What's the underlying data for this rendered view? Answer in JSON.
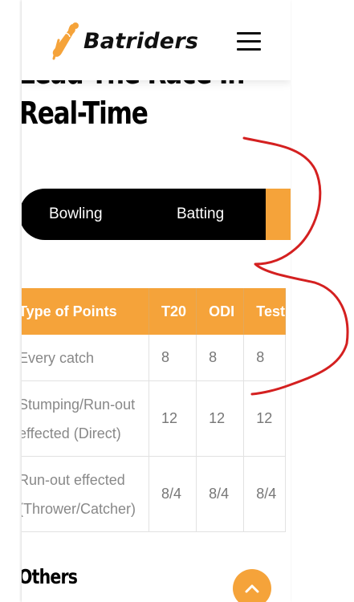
{
  "brand": {
    "name": "Batriders",
    "logo_icon": "bat-ball-logo-icon",
    "accent_color": "#f5a33a"
  },
  "header": {
    "menu_icon": "hamburger-menu-icon"
  },
  "hero": {
    "title_line1": "Lead The Race In",
    "title_line2": "Real-Time"
  },
  "tabs": {
    "items": [
      "Bowling",
      "Batting"
    ],
    "active_color": "#f5a33a"
  },
  "points_table": {
    "columns": [
      "Type of Points",
      "T20",
      "ODI",
      "Test"
    ],
    "rows": [
      {
        "type_line1": "Every catch",
        "type_line2": "",
        "t20": "8",
        "odi": "8",
        "test": "8"
      },
      {
        "type_line1": "Stumping/Run-out",
        "type_line2": "effected (Direct)",
        "t20": "12",
        "odi": "12",
        "test": "12"
      },
      {
        "type_line1": "Run-out effected",
        "type_line2": "(Thrower/Catcher)",
        "t20": "8/4",
        "odi": "8/4",
        "test": "8/4"
      }
    ]
  },
  "section": {
    "others_heading": "Others"
  },
  "scroll_top": {
    "icon": "chevron-up-icon"
  },
  "annotation": {
    "color": "#d42020"
  }
}
